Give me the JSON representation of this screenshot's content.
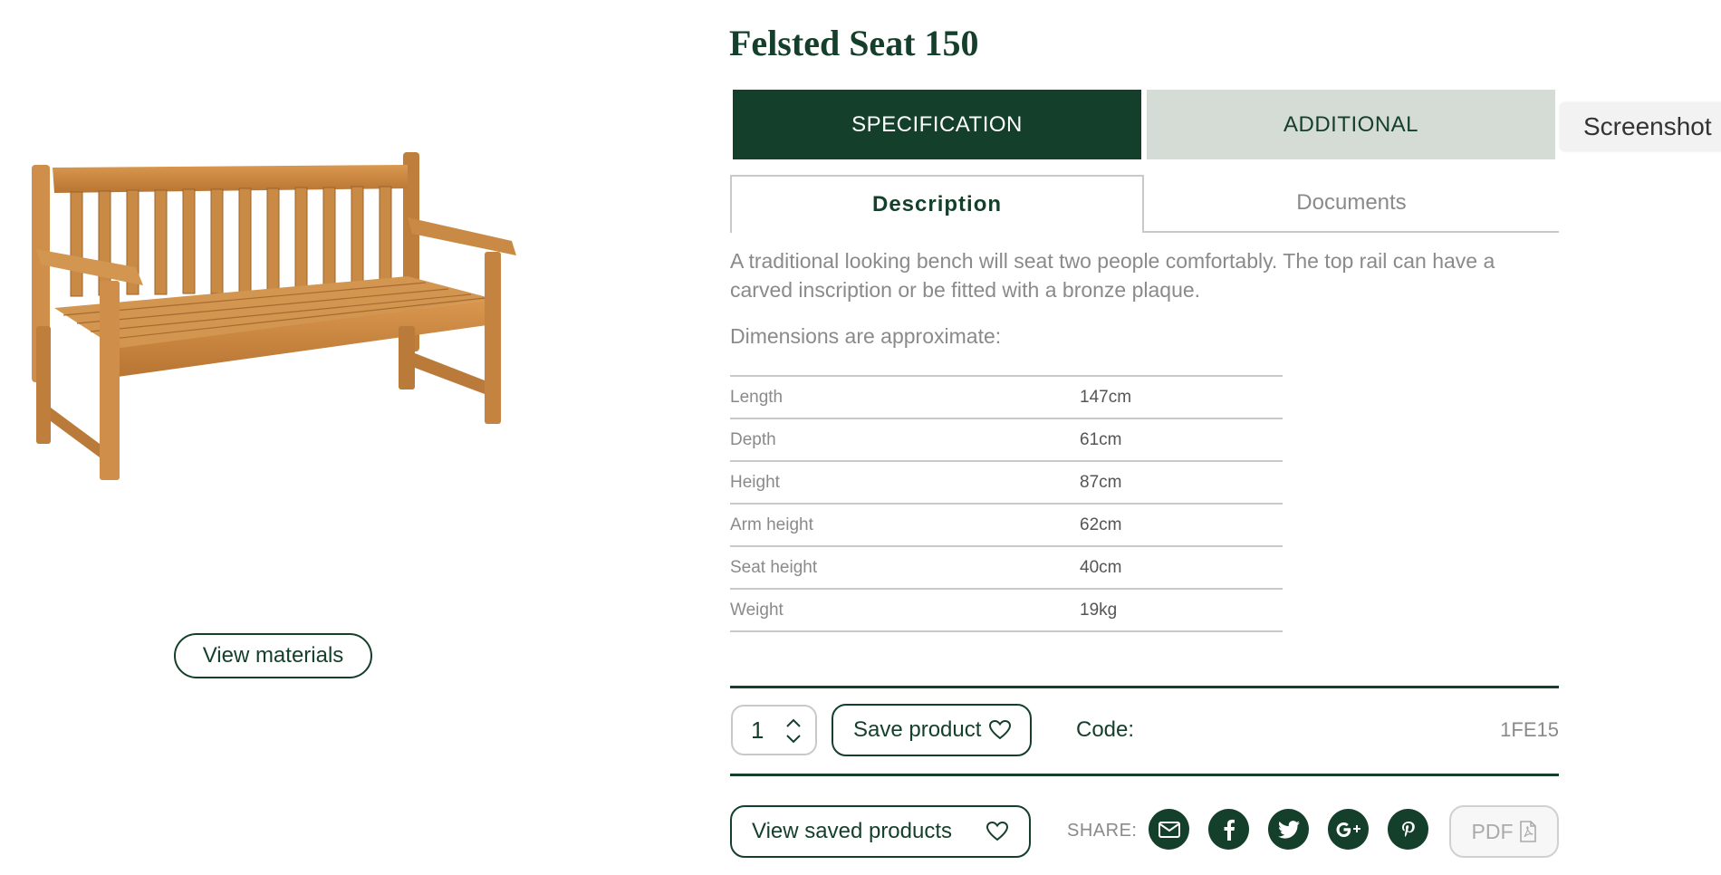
{
  "product": {
    "title": "Felsted Seat 150",
    "image_alt": "teak bench",
    "view_materials_label": "View materials"
  },
  "tabs": {
    "main": [
      {
        "label": "SPECIFICATION",
        "active": true
      },
      {
        "label": "ADDITIONAL",
        "active": false
      }
    ],
    "sub": [
      {
        "label": "Description",
        "active": true
      },
      {
        "label": "Documents",
        "active": false
      }
    ]
  },
  "screenshot_button": "Screenshot",
  "description": {
    "text": "A traditional looking bench will seat two people comfortably. The top rail can have a carved inscription or be fitted with a bronze plaque.",
    "dimensions_heading": "Dimensions are approximate:"
  },
  "dimensions": [
    {
      "label": "Length",
      "value": "147cm"
    },
    {
      "label": "Depth",
      "value": "61cm"
    },
    {
      "label": "Height",
      "value": "87cm"
    },
    {
      "label": "Arm height",
      "value": "62cm"
    },
    {
      "label": "Seat height",
      "value": "40cm"
    },
    {
      "label": "Weight",
      "value": "19kg"
    }
  ],
  "actions": {
    "quantity": "1",
    "save_product_label": "Save product",
    "code_label": "Code:",
    "code_value": "1FE15",
    "view_saved_label": "View saved products",
    "share_label": "SHARE:",
    "share_icons": [
      "email-icon",
      "facebook-icon",
      "twitter-icon",
      "google-plus-icon",
      "pinterest-icon"
    ],
    "pdf_label": "PDF"
  },
  "colors": {
    "brand_green": "#143f2b",
    "inactive_tab": "#d5dbd5",
    "muted_text": "#8a8a8a",
    "wood": "#c98a45"
  }
}
